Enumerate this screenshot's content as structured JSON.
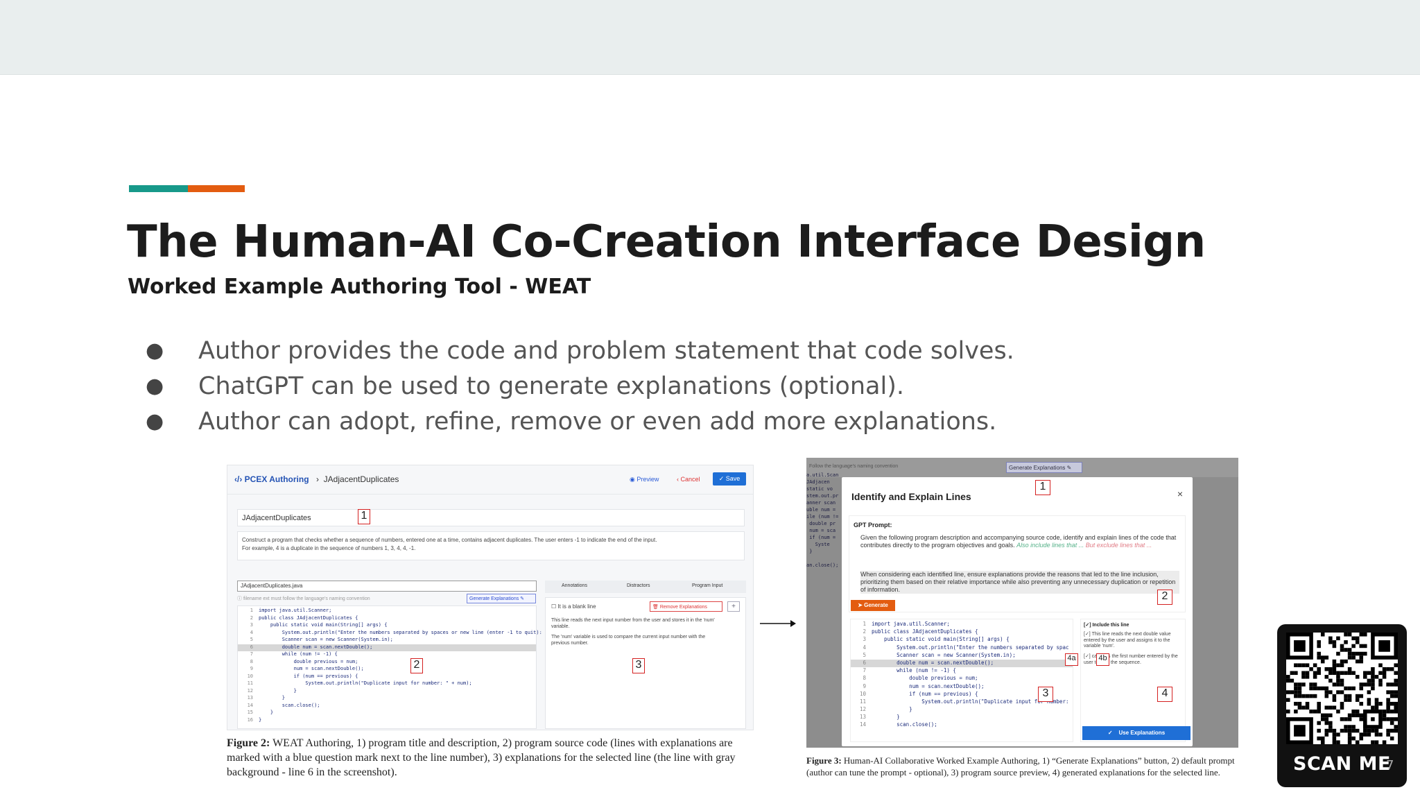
{
  "slide": {
    "title": "The Human-AI Co-Creation Interface Design",
    "subtitle": "Worked Example Authoring Tool - WEAT",
    "bullets": [
      "Author provides the code and problem statement that code solves.",
      "ChatGPT can be used to generate explanations (optional).",
      "Author can adopt, refine, remove or even add more explanations."
    ],
    "colors": {
      "accent_teal": "#17998a",
      "accent_orange": "#e35c10"
    },
    "page_number": "7"
  },
  "figure2": {
    "brand": "PCEX Authoring",
    "breadcrumb": "JAdjacentDuplicates",
    "preview_label": "Preview",
    "cancel_label": "Cancel",
    "save_label": "Save",
    "program_title": "JAdjacentDuplicates",
    "description_line1": "Construct a program that checks whether a sequence of numbers, entered one at a time, contains adjacent duplicates. The user enters -1 to indicate the end of the input.",
    "description_line2": "For example, 4 is a duplicate in the sequence of numbers 1, 3, 4, 4, -1.",
    "file_name": "JAdjacentDuplicates.java",
    "filename_hint": "filename ext must follow the language's naming convention",
    "generate_label": "Generate Explanations",
    "tabs": [
      "Annotations",
      "Distractors",
      "Program Input"
    ],
    "blank_line_label": "It is a blank line",
    "remove_label": "Remove Explanations",
    "add_label": "+",
    "explanations": [
      "This line reads the next input number from the user and stores it in the 'num' variable.",
      "The 'num' variable is used to compare the current input number with the previous number."
    ],
    "code_lines": [
      {
        "n": "1",
        "text": "import java.util.Scanner;"
      },
      {
        "n": "2",
        "text": "public class JAdjacentDuplicates {"
      },
      {
        "n": "3",
        "text": "    public static void main(String[] args) {"
      },
      {
        "n": "4",
        "text": "        System.out.println(\"Enter the numbers separated by spaces or new line (enter -1 to quit):"
      },
      {
        "n": "5",
        "text": "        Scanner scan = new Scanner(System.in);"
      },
      {
        "n": "6",
        "text": "        double num = scan.nextDouble();"
      },
      {
        "n": "7",
        "text": "        while (num != -1) {"
      },
      {
        "n": "8",
        "text": "            double previous = num;"
      },
      {
        "n": "9",
        "text": "            num = scan.nextDouble();"
      },
      {
        "n": "10",
        "text": "            if (num == previous) {"
      },
      {
        "n": "11",
        "text": "                System.out.println(\"Duplicate input for number: \" + num);"
      },
      {
        "n": "12",
        "text": "            }"
      },
      {
        "n": "13",
        "text": "        }"
      },
      {
        "n": "14",
        "text": "        scan.close();"
      },
      {
        "n": "15",
        "text": "    }"
      },
      {
        "n": "16",
        "text": "}"
      }
    ],
    "markers": [
      "1",
      "2",
      "3"
    ],
    "caption_label": "Figure 2:",
    "caption_text": " WEAT Authoring, 1) program title and description, 2) program source code (lines with explanations are marked with a blue question mark next to the line number), 3) explanations for the selected line (the line with gray background - line 6 in the screenshot)."
  },
  "figure3": {
    "follow_hint": "Follow the language's naming convention",
    "generate_button": "Generate Explanations",
    "modal_title": "Identify and Explain Lines",
    "close": "×",
    "prompt_label": "GPT Prompt:",
    "prompt_p1": "Given the following program description and accompanying source code, identify and explain lines of the code that contributes directly to the program objectives and goals.",
    "prompt_p1_green": "Also include lines that ...",
    "prompt_p1_pink": "But exclude lines that ...",
    "prompt_p2": "When considering each identified line, ensure explanations provide the reasons that led to the line inclusion, prioritizing them based on their relative importance while also preventing any unnecessary duplication or repetition of information.",
    "generate_label": "Generate",
    "include_label": "Include this line",
    "explanation1": "This line reads the next double value entered by the user and assigns it to the variable 'num'.",
    "explanation2": "captures the first number entered by the user to start the sequence.",
    "use_label": "Use Explanations",
    "code_lines": [
      {
        "n": "1",
        "text": "import java.util.Scanner;"
      },
      {
        "n": "2",
        "text": "public class JAdjacentDuplicates {"
      },
      {
        "n": "3",
        "text": "    public static void main(String[] args) {"
      },
      {
        "n": "4",
        "text": "        System.out.println(\"Enter the numbers separated by spac"
      },
      {
        "n": "5",
        "text": "        Scanner scan = new Scanner(System.in);"
      },
      {
        "n": "6",
        "text": "        double num = scan.nextDouble();"
      },
      {
        "n": "7",
        "text": "        while (num != -1) {"
      },
      {
        "n": "8",
        "text": "            double previous = num;"
      },
      {
        "n": "9",
        "text": "            num = scan.nextDouble();"
      },
      {
        "n": "10",
        "text": "            if (num == previous) {"
      },
      {
        "n": "11",
        "text": "                System.out.println(\"Duplicate input for number:"
      },
      {
        "n": "12",
        "text": "            }"
      },
      {
        "n": "13",
        "text": "        }"
      },
      {
        "n": "14",
        "text": "        scan.close();"
      }
    ],
    "markers": [
      "1",
      "2",
      "3",
      "4",
      "4a",
      "4b"
    ],
    "caption_label": "Figure 3:",
    "caption_text": " Human-AI Collaborative Worked Example Authoring, 1) “Generate Explanations” button, 2) default prompt (author can tune the prompt - optional), 3) program source preview, 4) generated explanations for the selected line."
  },
  "qr": {
    "label": "SCAN ME"
  }
}
